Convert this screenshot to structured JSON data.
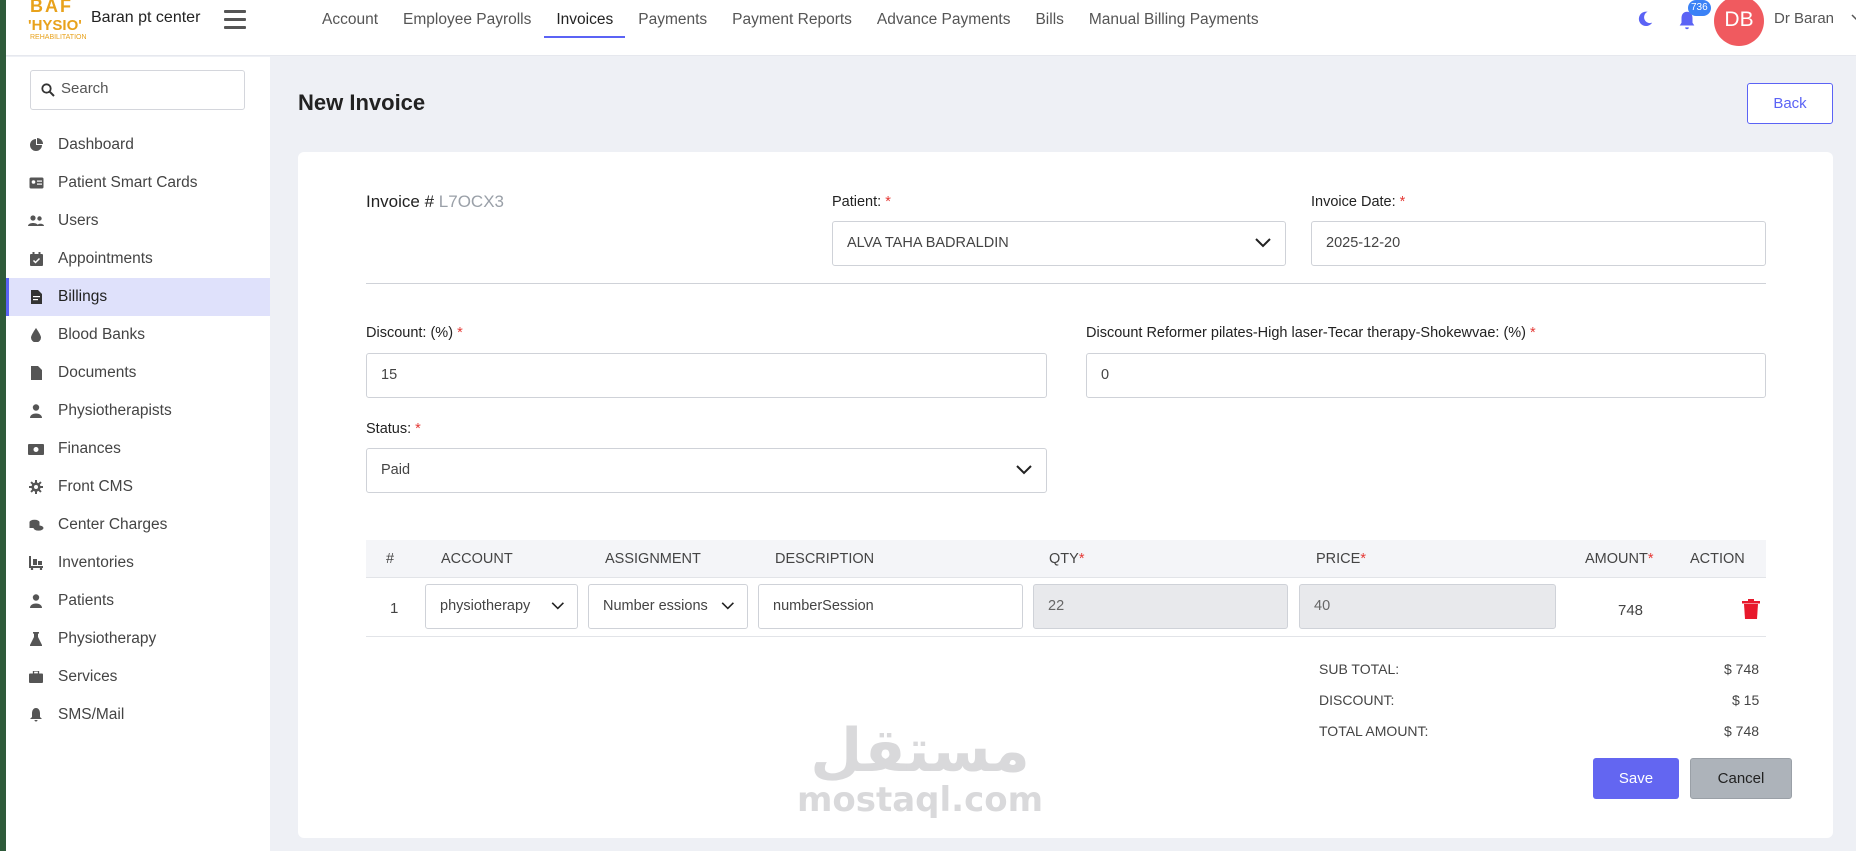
{
  "app": {
    "logo_line1": "BAF",
    "logo_line2": "'HYSIO'",
    "logo_line3": "REHABILITATION",
    "brand": "Baran pt center"
  },
  "topnav": [
    {
      "label": "Account",
      "active": false
    },
    {
      "label": "Employee Payrolls",
      "active": false
    },
    {
      "label": "Invoices",
      "active": true
    },
    {
      "label": "Payments",
      "active": false
    },
    {
      "label": "Payment Reports",
      "active": false
    },
    {
      "label": "Advance Payments",
      "active": false
    },
    {
      "label": "Bills",
      "active": false
    },
    {
      "label": "Manual Billing Payments",
      "active": false
    }
  ],
  "header": {
    "notification_count": "736",
    "avatar_initials": "DB",
    "user_name": "Dr Baran"
  },
  "sidebar": {
    "search_placeholder": "Search",
    "items": [
      {
        "label": "Dashboard",
        "icon": "pie-chart-icon",
        "active": false
      },
      {
        "label": "Patient Smart Cards",
        "icon": "id-card-icon",
        "active": false
      },
      {
        "label": "Users",
        "icon": "users-icon",
        "active": false
      },
      {
        "label": "Appointments",
        "icon": "calendar-check-icon",
        "active": false
      },
      {
        "label": "Billings",
        "icon": "invoice-icon",
        "active": true
      },
      {
        "label": "Blood Banks",
        "icon": "droplet-icon",
        "active": false
      },
      {
        "label": "Documents",
        "icon": "file-icon",
        "active": false
      },
      {
        "label": "Physiotherapists",
        "icon": "user-doctor-icon",
        "active": false
      },
      {
        "label": "Finances",
        "icon": "money-icon",
        "active": false
      },
      {
        "label": "Front CMS",
        "icon": "gear-icon",
        "active": false
      },
      {
        "label": "Center Charges",
        "icon": "coins-icon",
        "active": false
      },
      {
        "label": "Inventories",
        "icon": "dolly-icon",
        "active": false
      },
      {
        "label": "Patients",
        "icon": "patient-icon",
        "active": false
      },
      {
        "label": "Physiotherapy",
        "icon": "flask-icon",
        "active": false
      },
      {
        "label": "Services",
        "icon": "briefcase-icon",
        "active": false
      },
      {
        "label": "SMS/Mail",
        "icon": "bell-icon",
        "active": false
      }
    ]
  },
  "page": {
    "title": "New Invoice",
    "back_label": "Back"
  },
  "form": {
    "invoice_label": "Invoice #",
    "invoice_code": "L7OCX3",
    "patient_label": "Patient:",
    "patient_value": "ALVA TAHA BADRALDIN",
    "invoice_date_label": "Invoice Date:",
    "invoice_date_value": "2025-12-20",
    "discount_label": "Discount: (%)",
    "discount_value": "15",
    "discount2_label": "Discount Reformer pilates-High laser-Tecar therapy-Shokewvae: (%)",
    "discount2_value": "0",
    "status_label": "Status:",
    "status_value": "Paid",
    "required_mark": "*"
  },
  "table": {
    "headers": {
      "num": "#",
      "account": "ACCOUNT",
      "assignment": "ASSIGNMENT",
      "description": "DESCRIPTION",
      "qty": "QTY",
      "price": "PRICE",
      "amount": "AMOUNT",
      "action": "ACTION"
    },
    "rows": [
      {
        "num": "1",
        "account": "physiotherapy",
        "assignment": "Number essions",
        "description": "numberSession",
        "qty": "22",
        "price": "40",
        "amount": "748"
      }
    ]
  },
  "totals": {
    "subtotal_label": "SUB TOTAL:",
    "subtotal_value": "$ 748",
    "discount_label": "DISCOUNT:",
    "discount_value": "$ 15",
    "total_label": "TOTAL AMOUNT:",
    "total_value": "$ 748"
  },
  "actions": {
    "save_label": "Save",
    "cancel_label": "Cancel"
  },
  "watermark": {
    "arabic": "مستقل",
    "latin": "mostaql.com"
  },
  "colors": {
    "accent": "#5b63f5",
    "required": "#e53935",
    "avatar": "#f05a5f",
    "trash": "#e8192c"
  }
}
